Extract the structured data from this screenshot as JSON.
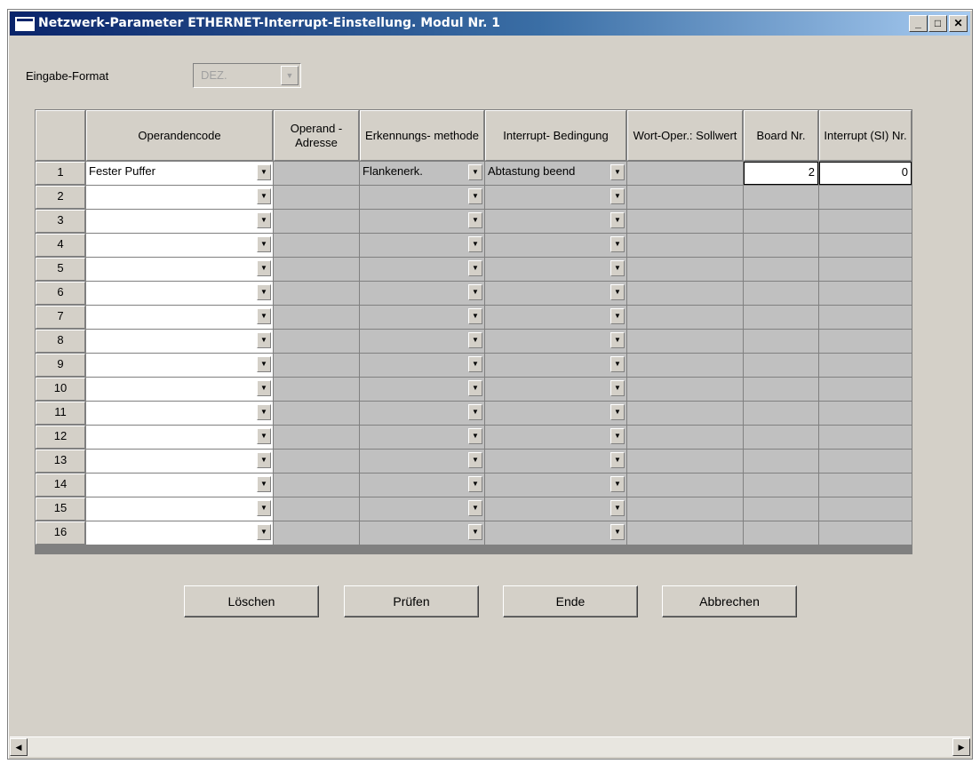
{
  "window": {
    "title": "Netzwerk-Parameter ETHERNET-Interrupt-Einstellung. Modul Nr. 1",
    "minimize": "_",
    "maximize": "□",
    "close": "✕"
  },
  "input_format": {
    "label": "Eingabe-Format",
    "value": "DEZ."
  },
  "table": {
    "headers": {
      "operandencode": "Operandencode",
      "operand_adresse": "Operand - Adresse",
      "erkennungsmethode": "Erkennungs- methode",
      "interrupt_bedingung": "Interrupt- Bedingung",
      "wort_oper_sollwert": "Wort-Oper.: Sollwert",
      "board_nr": "Board Nr.",
      "interrupt_si_nr": "Interrupt (SI) Nr."
    },
    "rows": [
      {
        "nr": "1",
        "operandencode": "Fester Puffer",
        "erkennungsmethode": "Flankenerk.",
        "interrupt_bedingung": "Abtastung beend",
        "board_nr": "2",
        "interrupt_si_nr": "0"
      },
      {
        "nr": "2"
      },
      {
        "nr": "3"
      },
      {
        "nr": "4"
      },
      {
        "nr": "5"
      },
      {
        "nr": "6"
      },
      {
        "nr": "7"
      },
      {
        "nr": "8"
      },
      {
        "nr": "9"
      },
      {
        "nr": "10"
      },
      {
        "nr": "11"
      },
      {
        "nr": "12"
      },
      {
        "nr": "13"
      },
      {
        "nr": "14"
      },
      {
        "nr": "15"
      },
      {
        "nr": "16"
      }
    ]
  },
  "buttons": {
    "loeschen": "Löschen",
    "pruefen": "Prüfen",
    "ende": "Ende",
    "abbrechen": "Abbrechen"
  },
  "icons": {
    "dropdown": "▼",
    "scroll_left": "◀",
    "scroll_right": "▶"
  }
}
